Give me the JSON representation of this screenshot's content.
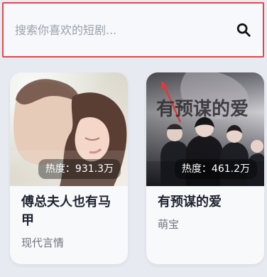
{
  "search": {
    "placeholder": "搜索你喜欢的短剧..."
  },
  "icons": {
    "search": "search-icon"
  },
  "cards": [
    {
      "heat": "热度：931.3万",
      "title": "傅总夫人也有马甲",
      "genre": "现代言情"
    },
    {
      "heat": "热度：461.2万",
      "title": "有预谋的爱",
      "genre": "萌宝",
      "poster_text": "有预谋的爱"
    }
  ],
  "colors": {
    "accent": "#e1474c",
    "background": "#e7eaf0"
  }
}
